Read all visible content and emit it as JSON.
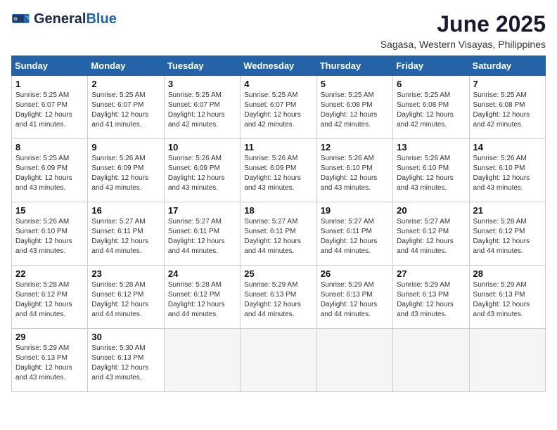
{
  "header": {
    "logo_general": "General",
    "logo_blue": "Blue",
    "month_title": "June 2025",
    "location": "Sagasa, Western Visayas, Philippines"
  },
  "days_of_week": [
    "Sunday",
    "Monday",
    "Tuesday",
    "Wednesday",
    "Thursday",
    "Friday",
    "Saturday"
  ],
  "weeks": [
    [
      {
        "day": "1",
        "sunrise": "5:25 AM",
        "sunset": "6:07 PM",
        "daylight": "12 hours and 41 minutes."
      },
      {
        "day": "2",
        "sunrise": "5:25 AM",
        "sunset": "6:07 PM",
        "daylight": "12 hours and 41 minutes."
      },
      {
        "day": "3",
        "sunrise": "5:25 AM",
        "sunset": "6:07 PM",
        "daylight": "12 hours and 42 minutes."
      },
      {
        "day": "4",
        "sunrise": "5:25 AM",
        "sunset": "6:07 PM",
        "daylight": "12 hours and 42 minutes."
      },
      {
        "day": "5",
        "sunrise": "5:25 AM",
        "sunset": "6:08 PM",
        "daylight": "12 hours and 42 minutes."
      },
      {
        "day": "6",
        "sunrise": "5:25 AM",
        "sunset": "6:08 PM",
        "daylight": "12 hours and 42 minutes."
      },
      {
        "day": "7",
        "sunrise": "5:25 AM",
        "sunset": "6:08 PM",
        "daylight": "12 hours and 42 minutes."
      }
    ],
    [
      {
        "day": "8",
        "sunrise": "5:25 AM",
        "sunset": "6:09 PM",
        "daylight": "12 hours and 43 minutes."
      },
      {
        "day": "9",
        "sunrise": "5:26 AM",
        "sunset": "6:09 PM",
        "daylight": "12 hours and 43 minutes."
      },
      {
        "day": "10",
        "sunrise": "5:26 AM",
        "sunset": "6:09 PM",
        "daylight": "12 hours and 43 minutes."
      },
      {
        "day": "11",
        "sunrise": "5:26 AM",
        "sunset": "6:09 PM",
        "daylight": "12 hours and 43 minutes."
      },
      {
        "day": "12",
        "sunrise": "5:26 AM",
        "sunset": "6:10 PM",
        "daylight": "12 hours and 43 minutes."
      },
      {
        "day": "13",
        "sunrise": "5:26 AM",
        "sunset": "6:10 PM",
        "daylight": "12 hours and 43 minutes."
      },
      {
        "day": "14",
        "sunrise": "5:26 AM",
        "sunset": "6:10 PM",
        "daylight": "12 hours and 43 minutes."
      }
    ],
    [
      {
        "day": "15",
        "sunrise": "5:26 AM",
        "sunset": "6:10 PM",
        "daylight": "12 hours and 43 minutes."
      },
      {
        "day": "16",
        "sunrise": "5:27 AM",
        "sunset": "6:11 PM",
        "daylight": "12 hours and 44 minutes."
      },
      {
        "day": "17",
        "sunrise": "5:27 AM",
        "sunset": "6:11 PM",
        "daylight": "12 hours and 44 minutes."
      },
      {
        "day": "18",
        "sunrise": "5:27 AM",
        "sunset": "6:11 PM",
        "daylight": "12 hours and 44 minutes."
      },
      {
        "day": "19",
        "sunrise": "5:27 AM",
        "sunset": "6:11 PM",
        "daylight": "12 hours and 44 minutes."
      },
      {
        "day": "20",
        "sunrise": "5:27 AM",
        "sunset": "6:12 PM",
        "daylight": "12 hours and 44 minutes."
      },
      {
        "day": "21",
        "sunrise": "5:28 AM",
        "sunset": "6:12 PM",
        "daylight": "12 hours and 44 minutes."
      }
    ],
    [
      {
        "day": "22",
        "sunrise": "5:28 AM",
        "sunset": "6:12 PM",
        "daylight": "12 hours and 44 minutes."
      },
      {
        "day": "23",
        "sunrise": "5:28 AM",
        "sunset": "6:12 PM",
        "daylight": "12 hours and 44 minutes."
      },
      {
        "day": "24",
        "sunrise": "5:28 AM",
        "sunset": "6:12 PM",
        "daylight": "12 hours and 44 minutes."
      },
      {
        "day": "25",
        "sunrise": "5:29 AM",
        "sunset": "6:13 PM",
        "daylight": "12 hours and 44 minutes."
      },
      {
        "day": "26",
        "sunrise": "5:29 AM",
        "sunset": "6:13 PM",
        "daylight": "12 hours and 44 minutes."
      },
      {
        "day": "27",
        "sunrise": "5:29 AM",
        "sunset": "6:13 PM",
        "daylight": "12 hours and 43 minutes."
      },
      {
        "day": "28",
        "sunrise": "5:29 AM",
        "sunset": "6:13 PM",
        "daylight": "12 hours and 43 minutes."
      }
    ],
    [
      {
        "day": "29",
        "sunrise": "5:29 AM",
        "sunset": "6:13 PM",
        "daylight": "12 hours and 43 minutes."
      },
      {
        "day": "30",
        "sunrise": "5:30 AM",
        "sunset": "6:13 PM",
        "daylight": "12 hours and 43 minutes."
      },
      null,
      null,
      null,
      null,
      null
    ]
  ],
  "labels": {
    "sunrise": "Sunrise:",
    "sunset": "Sunset:",
    "daylight": "Daylight:"
  }
}
